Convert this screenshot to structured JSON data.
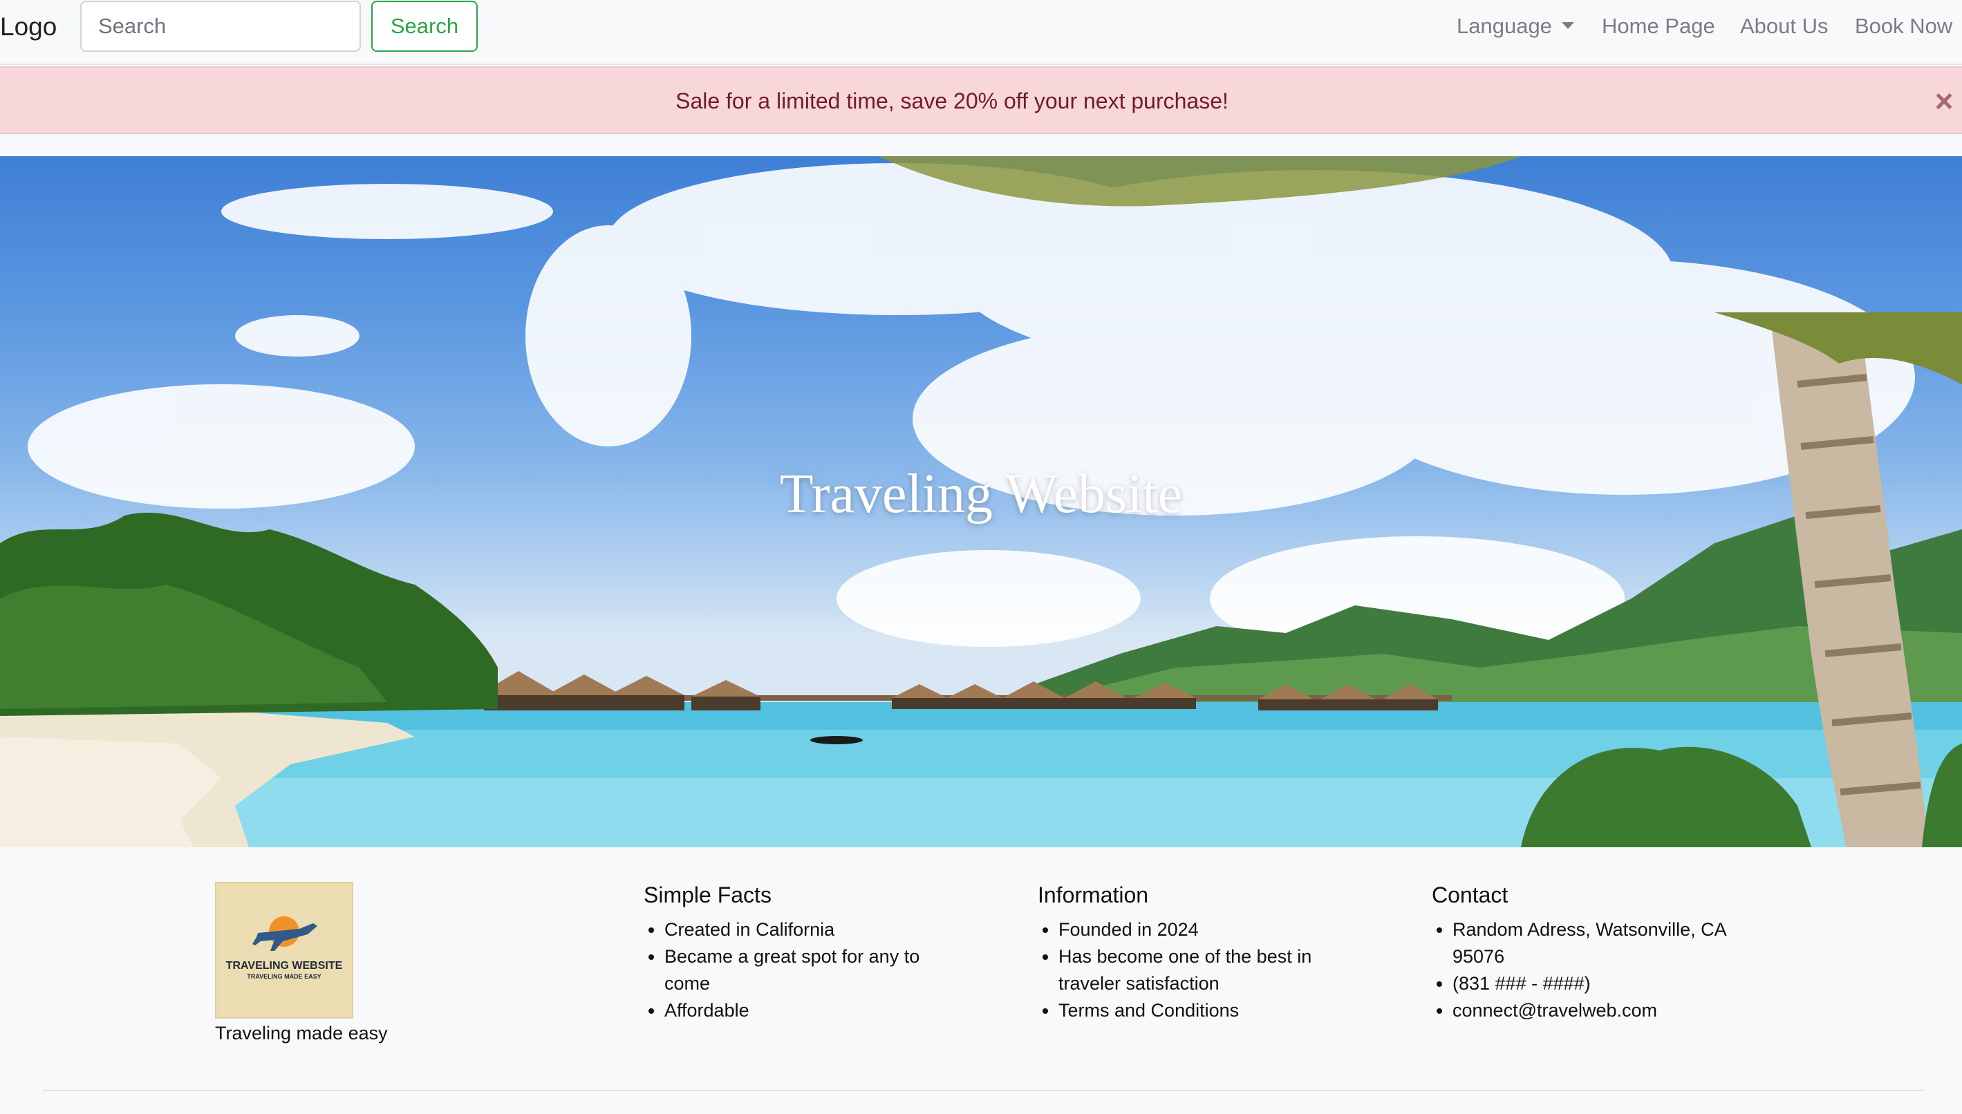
{
  "navbar": {
    "brand": "Logo",
    "search_placeholder": "Search",
    "search_button": "Search",
    "language_label": "Language",
    "home_label": "Home Page",
    "about_label": "About Us",
    "book_label": "Book Now"
  },
  "alert": {
    "message": "Sale for a limited time, save 20% off your next purchase!",
    "close_symbol": "×"
  },
  "hero": {
    "title": "Traveling Website"
  },
  "footer": {
    "logo_text_1": "TRAVELING WEBSITE",
    "logo_text_2": "TRAVELING MADE EASY",
    "caption": "Traveling made easy",
    "columns": [
      {
        "title": "Simple Facts",
        "items": [
          "Created in California",
          "Became a great spot for any to come",
          "Affordable"
        ]
      },
      {
        "title": "Information",
        "items": [
          "Founded in 2024",
          "Has become one of the best in traveler satisfaction",
          "Terms and Conditions"
        ]
      },
      {
        "title": "Contact",
        "items": [
          "Random Adress, Watsonville, CA 95076",
          "(831 ### - ####)",
          "connect@travelweb.com"
        ]
      }
    ]
  },
  "colors": {
    "success": "#28a745",
    "alert_bg": "#f8d7da",
    "alert_text": "#721c24",
    "nav_text": "#7a7d81"
  },
  "icons": {
    "close": "close-icon",
    "caret": "chevron-down-icon"
  }
}
